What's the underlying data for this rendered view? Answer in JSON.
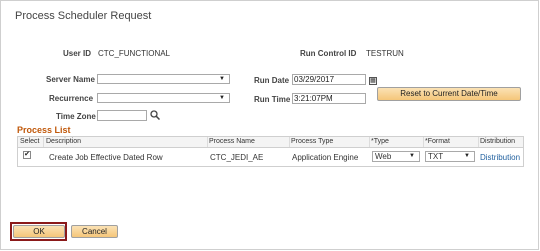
{
  "page": {
    "title": "Process Scheduler Request"
  },
  "header": {
    "user_id_label": "User ID",
    "user_id_value": "CTC_FUNCTIONAL",
    "run_control_label": "Run Control ID",
    "run_control_value": "TESTRUN"
  },
  "form": {
    "server_name_label": "Server Name",
    "server_name_value": "",
    "recurrence_label": "Recurrence",
    "recurrence_value": "",
    "time_zone_label": "Time Zone",
    "time_zone_value": "",
    "run_date_label": "Run Date",
    "run_date_value": "03/29/2017",
    "run_time_label": "Run Time",
    "run_time_value": "3:21:07PM",
    "reset_button": "Reset to Current Date/Time"
  },
  "process_list": {
    "title": "Process List",
    "columns": [
      "Select",
      "Description",
      "Process Name",
      "Process Type",
      "*Type",
      "*Format",
      "Distribution"
    ],
    "rows": [
      {
        "selected": true,
        "check_mark": "✔",
        "description": "Create Job Effective Dated Row",
        "process_name": "CTC_JEDI_AE",
        "process_type": "Application Engine",
        "type": "Web",
        "format": "TXT",
        "distribution": "Distribution"
      }
    ]
  },
  "footer": {
    "ok_label": "OK",
    "cancel_label": "Cancel"
  },
  "icons": {
    "calendar": "calendar-icon",
    "search": "search-icon",
    "dropdown": "chevron-down-icon"
  },
  "colors": {
    "section_title": "#c0580a",
    "button": "#f5c67a",
    "ok_highlight": "#8b1a1a",
    "link": "#1f5f9e"
  }
}
